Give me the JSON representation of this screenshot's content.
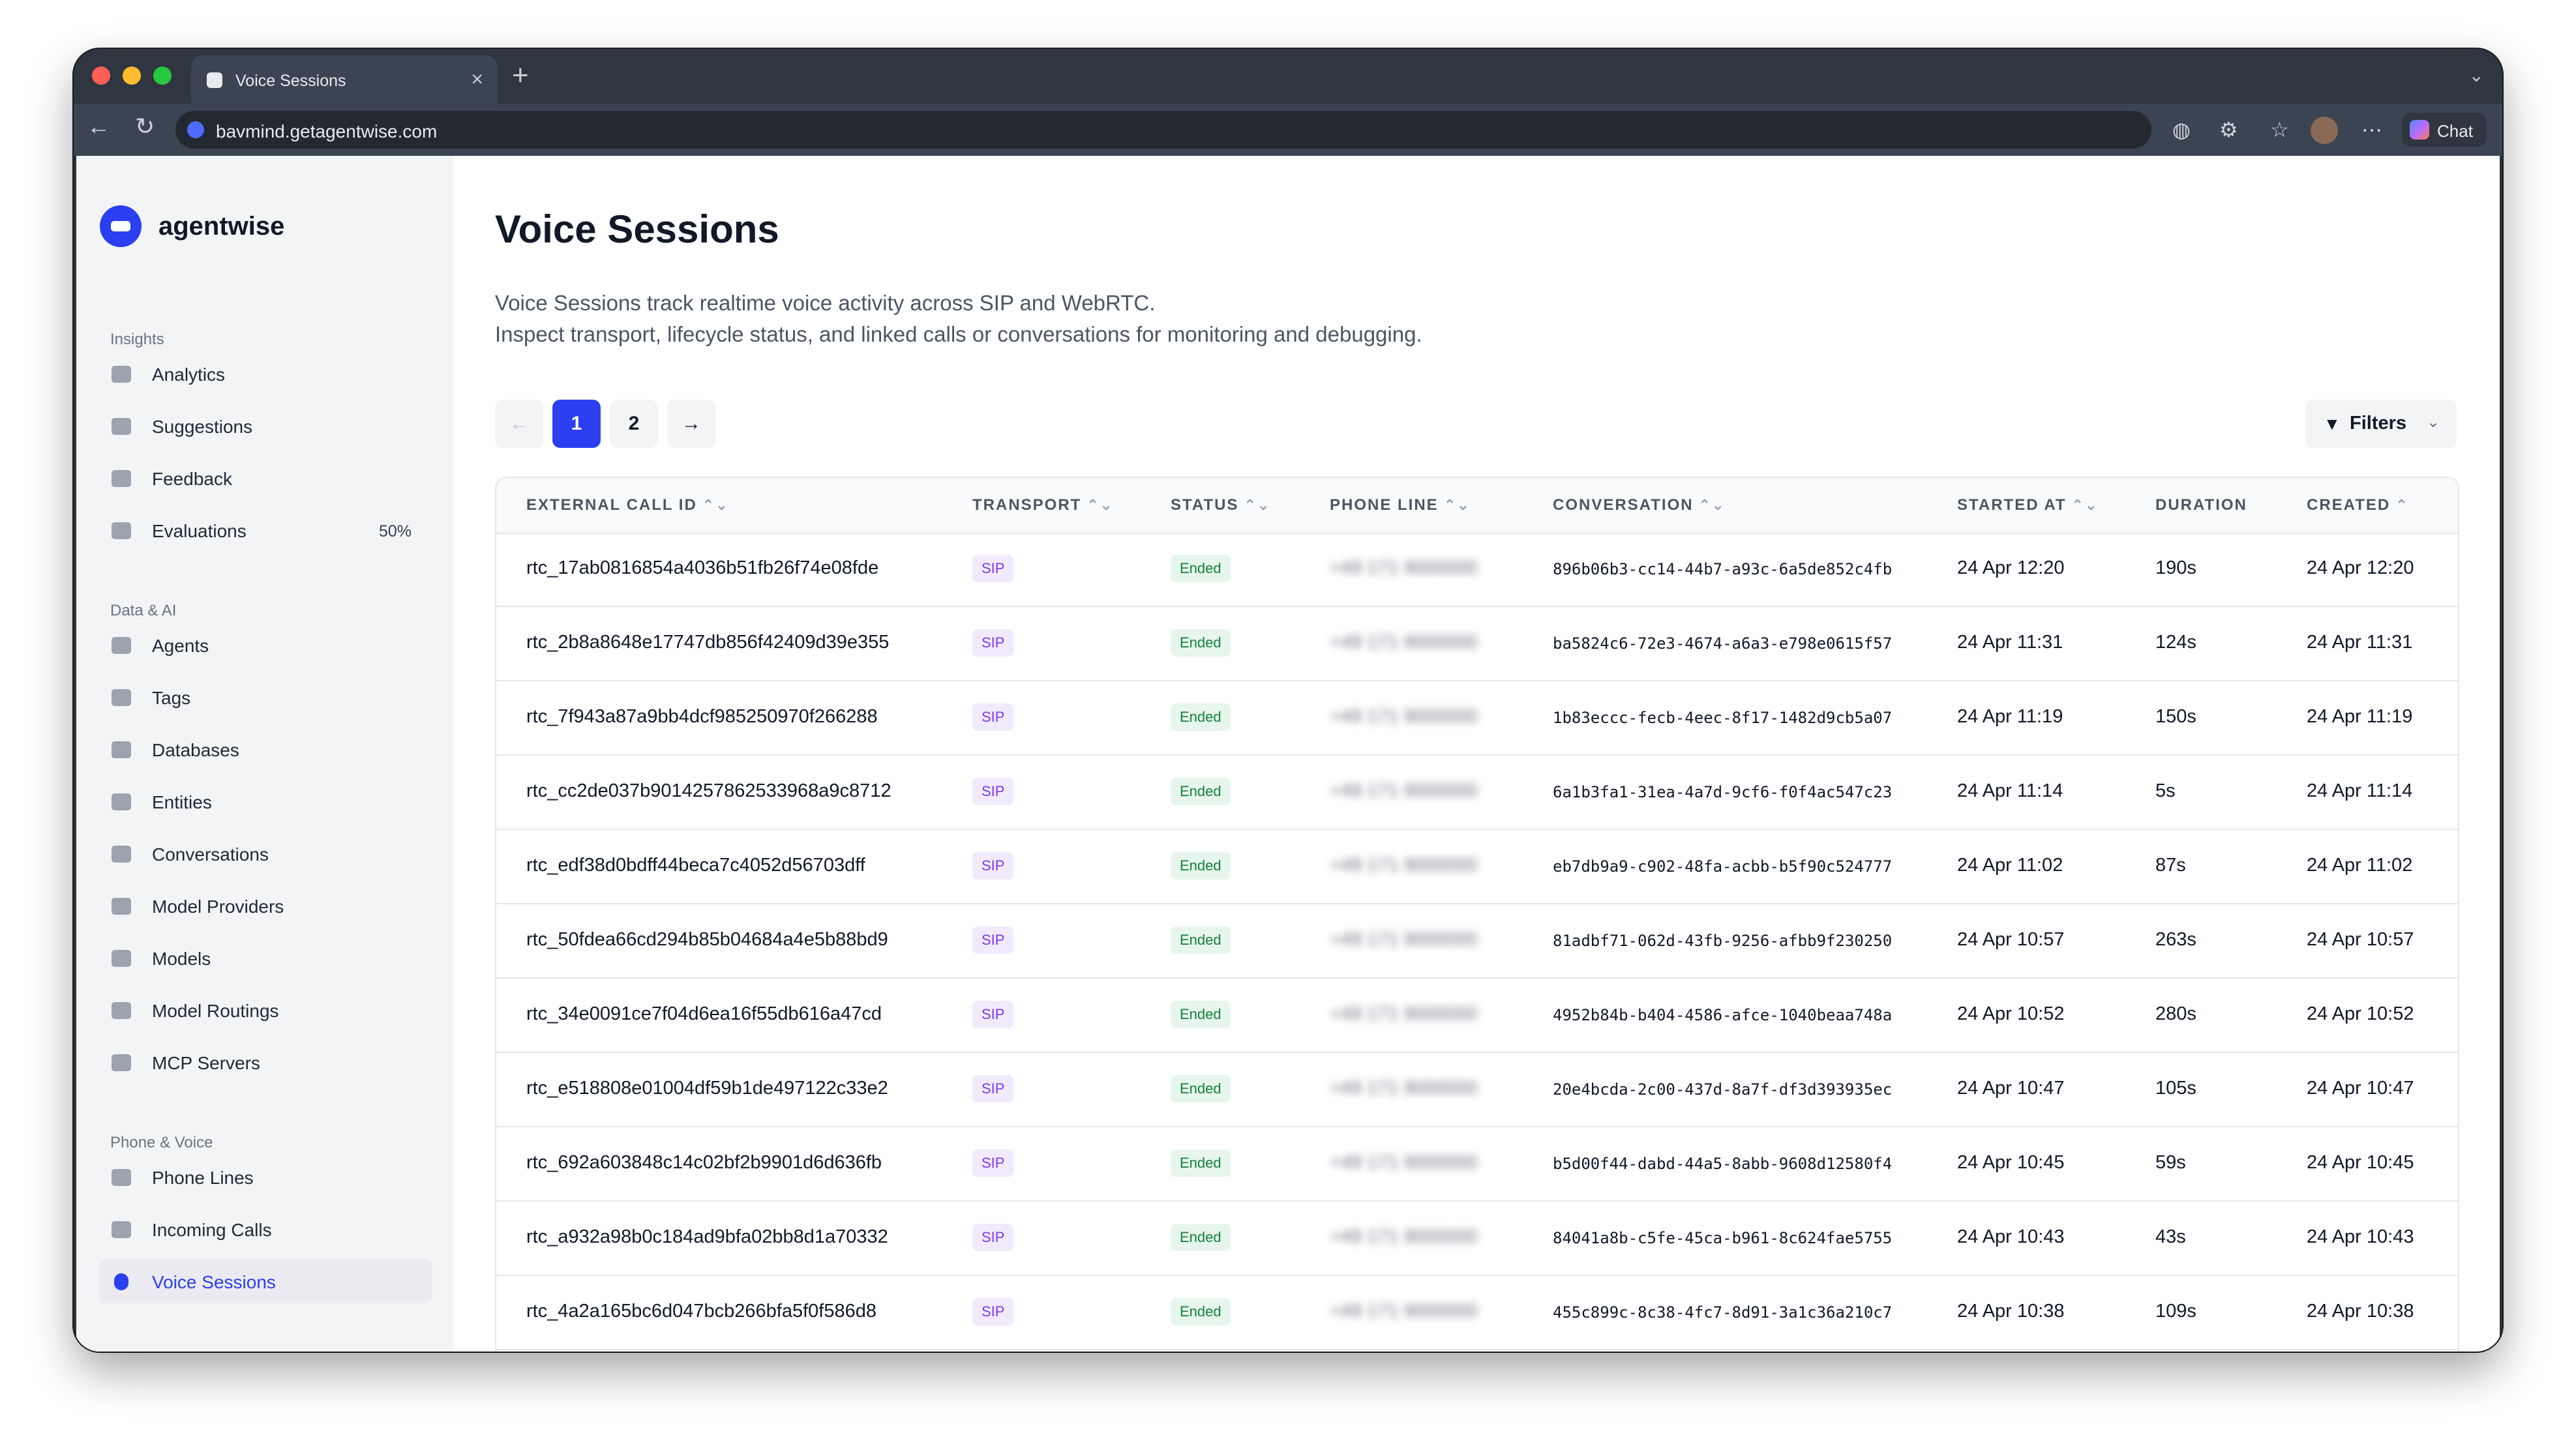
{
  "browser": {
    "tab_title": "Voice Sessions",
    "tab_close": "×",
    "new_tab": "+",
    "url": "bavmind.getagentwise.com",
    "chat_label": "Chat"
  },
  "sidebar": {
    "brand": "agentwise",
    "sections": [
      {
        "title": "Insights",
        "items": [
          {
            "label": "Analytics",
            "icon": "chart-icon"
          },
          {
            "label": "Suggestions",
            "icon": "sparkle-icon"
          },
          {
            "label": "Feedback",
            "icon": "thumbs-up-icon"
          },
          {
            "label": "Evaluations",
            "icon": "clipboard-icon",
            "badge": "50%"
          }
        ]
      },
      {
        "title": "Data & AI",
        "items": [
          {
            "label": "Agents",
            "icon": "id-card-icon"
          },
          {
            "label": "Tags",
            "icon": "tag-icon"
          },
          {
            "label": "Databases",
            "icon": "database-icon"
          },
          {
            "label": "Entities",
            "icon": "cube-icon"
          },
          {
            "label": "Conversations",
            "icon": "chat-bubbles-icon"
          },
          {
            "label": "Model Providers",
            "icon": "document-icon"
          },
          {
            "label": "Models",
            "icon": "chip-icon"
          },
          {
            "label": "Model Routings",
            "icon": "arrows-icon"
          },
          {
            "label": "MCP Servers",
            "icon": "grid-icon"
          }
        ]
      },
      {
        "title": "Phone & Voice",
        "items": [
          {
            "label": "Phone Lines",
            "icon": "phone-icon"
          },
          {
            "label": "Incoming Calls",
            "icon": "phone-incoming-icon"
          },
          {
            "label": "Voice Sessions",
            "icon": "microphone-icon",
            "active": true
          }
        ]
      }
    ]
  },
  "page": {
    "title": "Voice Sessions",
    "description_line1": "Voice Sessions track realtime voice activity across SIP and WebRTC.",
    "description_line2": "Inspect transport, lifecycle status, and linked calls or conversations for monitoring and debugging.",
    "pagination": {
      "prev": "←",
      "pages": [
        "1",
        "2"
      ],
      "current": "1",
      "next": "→"
    },
    "filters_label": "Filters"
  },
  "table": {
    "columns": [
      "EXTERNAL CALL ID",
      "TRANSPORT",
      "STATUS",
      "PHONE LINE",
      "CONVERSATION",
      "STARTED AT",
      "DURATION",
      "CREATED"
    ],
    "sort_glyph": "⌃⌄",
    "created_sort_glyph": "⌃",
    "phone_line_placeholder": "+49 171 9000000",
    "rows": [
      {
        "id": "rtc_17ab0816854a4036b51fb26f74e08fde",
        "transport": "SIP",
        "status": "Ended",
        "conversation": "896b06b3-cc14-44b7-a93c-6a5de852c4fb",
        "started": "24 Apr 12:20",
        "duration": "190s",
        "created": "24 Apr 12:20"
      },
      {
        "id": "rtc_2b8a8648e17747db856f42409d39e355",
        "transport": "SIP",
        "status": "Ended",
        "conversation": "ba5824c6-72e3-4674-a6a3-e798e0615f57",
        "started": "24 Apr 11:31",
        "duration": "124s",
        "created": "24 Apr 11:31"
      },
      {
        "id": "rtc_7f943a87a9bb4dcf985250970f266288",
        "transport": "SIP",
        "status": "Ended",
        "conversation": "1b83eccc-fecb-4eec-8f17-1482d9cb5a07",
        "started": "24 Apr 11:19",
        "duration": "150s",
        "created": "24 Apr 11:19"
      },
      {
        "id": "rtc_cc2de037b9014257862533968a9c8712",
        "transport": "SIP",
        "status": "Ended",
        "conversation": "6a1b3fa1-31ea-4a7d-9cf6-f0f4ac547c23",
        "started": "24 Apr 11:14",
        "duration": "5s",
        "created": "24 Apr 11:14"
      },
      {
        "id": "rtc_edf38d0bdff44beca7c4052d56703dff",
        "transport": "SIP",
        "status": "Ended",
        "conversation": "eb7db9a9-c902-48fa-acbb-b5f90c524777",
        "started": "24 Apr 11:02",
        "duration": "87s",
        "created": "24 Apr 11:02"
      },
      {
        "id": "rtc_50fdea66cd294b85b04684a4e5b88bd9",
        "transport": "SIP",
        "status": "Ended",
        "conversation": "81adbf71-062d-43fb-9256-afbb9f230250",
        "started": "24 Apr 10:57",
        "duration": "263s",
        "created": "24 Apr 10:57"
      },
      {
        "id": "rtc_34e0091ce7f04d6ea16f55db616a47cd",
        "transport": "SIP",
        "status": "Ended",
        "conversation": "4952b84b-b404-4586-afce-1040beaa748a",
        "started": "24 Apr 10:52",
        "duration": "280s",
        "created": "24 Apr 10:52"
      },
      {
        "id": "rtc_e518808e01004df59b1de497122c33e2",
        "transport": "SIP",
        "status": "Ended",
        "conversation": "20e4bcda-2c00-437d-8a7f-df3d393935ec",
        "started": "24 Apr 10:47",
        "duration": "105s",
        "created": "24 Apr 10:47"
      },
      {
        "id": "rtc_692a603848c14c02bf2b9901d6d636fb",
        "transport": "SIP",
        "status": "Ended",
        "conversation": "b5d00f44-dabd-44a5-8abb-9608d12580f4",
        "started": "24 Apr 10:45",
        "duration": "59s",
        "created": "24 Apr 10:45"
      },
      {
        "id": "rtc_a932a98b0c184ad9bfa02bb8d1a70332",
        "transport": "SIP",
        "status": "Ended",
        "conversation": "84041a8b-c5fe-45ca-b961-8c624fae5755",
        "started": "24 Apr 10:43",
        "duration": "43s",
        "created": "24 Apr 10:43"
      },
      {
        "id": "rtc_4a2a165bc6d047bcb266bfa5f0f586d8",
        "transport": "SIP",
        "status": "Ended",
        "conversation": "455c899c-8c38-4fc7-8d91-3a1c36a210c7",
        "started": "24 Apr 10:38",
        "duration": "109s",
        "created": "24 Apr 10:38"
      }
    ]
  },
  "colors": {
    "accent": "#2b3ff0",
    "sip_chip": "#7c3aed",
    "ended_chip": "#15803d"
  }
}
